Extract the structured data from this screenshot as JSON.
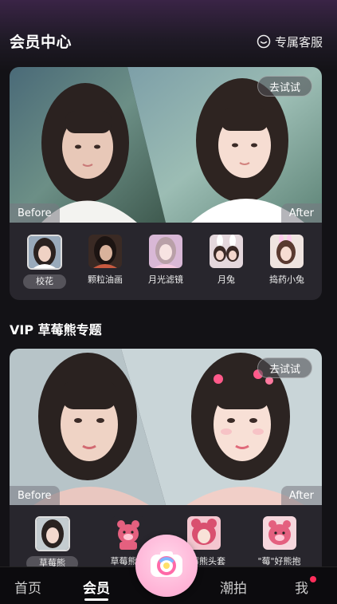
{
  "header": {
    "title": "会员中心",
    "service_label": "专属客服"
  },
  "card1": {
    "try_label": "去试试",
    "before_label": "Before",
    "after_label": "After",
    "filters": [
      {
        "label": "校花",
        "selected": true
      },
      {
        "label": "颗粒油画",
        "selected": false
      },
      {
        "label": "月光滤镜",
        "selected": false
      },
      {
        "label": "月兔",
        "selected": false
      },
      {
        "label": "捣药小兔",
        "selected": false
      }
    ]
  },
  "section": {
    "title": "VIP 草莓熊专题"
  },
  "card2": {
    "try_label": "去试试",
    "before_label": "Before",
    "after_label": "After",
    "filters": [
      {
        "label": "草莓熊",
        "selected": true
      },
      {
        "label": "草莓熊伴",
        "selected": false
      },
      {
        "label": "草莓熊头套",
        "selected": false
      },
      {
        "label": "\"莓\"好熊抱",
        "selected": false
      }
    ]
  },
  "nav": {
    "items": [
      "首页",
      "会员",
      "潮拍",
      "我"
    ],
    "active": "会员"
  },
  "colors": {
    "background": "#131216",
    "accent_pink": "#ffb3d6",
    "badge_red": "#ff2e5b"
  }
}
